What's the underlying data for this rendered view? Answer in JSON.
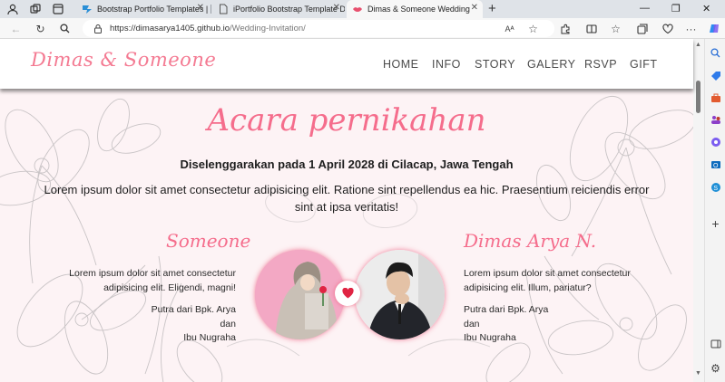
{
  "browser": {
    "tabs": [
      {
        "title": "Bootstrap Portfolio Templates | B",
        "active": false
      },
      {
        "title": "iPortfolio Bootstrap Template De",
        "active": false
      },
      {
        "title": "Dimas & Someone Wedding",
        "active": true
      }
    ],
    "url_host": "https://dimasarya1405.github.io",
    "url_path": "/Wedding-Invitation/"
  },
  "site": {
    "brand": "Dimas & Someone",
    "nav": [
      "HOME",
      "INFO",
      "STORY",
      "GALERY",
      "RSVP",
      "GIFT"
    ],
    "section_title": "Acara pernikahan",
    "event_line": "Diselenggarakan pada 1 April 2028 di Cilacap, Jawa Tengah",
    "description": "Lorem ipsum dolor sit amet consectetur adipisicing elit. Ratione sint repellendus ea hic. Praesentium reiciendis error sint at ipsa veritatis!",
    "bride": {
      "name": "Someone",
      "bio_line1": "Lorem ipsum dolor sit amet consectetur",
      "bio_line2": "adipisicing elit. Eligendi, magni!",
      "parents_line1": "Putra dari Bpk. Arya",
      "parents_line2": "dan",
      "parents_line3": "Ibu Nugraha"
    },
    "groom": {
      "name": "Dimas Arya N.",
      "bio_line1": "Lorem ipsum dolor sit amet consectetur",
      "bio_line2": "adipisicing elit. Illum, pariatur?",
      "parents_line1": "Putra dari Bpk. Arya",
      "parents_line2": "dan",
      "parents_line3": "Ibu Nugraha"
    }
  },
  "colors": {
    "accent_pink": "#f56d8c",
    "page_bg": "#fdf3f5",
    "heart_red": "#e02443"
  }
}
